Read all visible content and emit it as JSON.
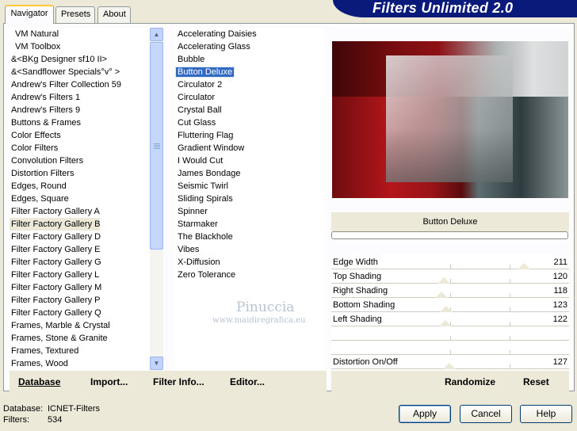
{
  "banner": {
    "title": "Filters Unlimited 2.0"
  },
  "tabs": [
    "Navigator",
    "Presets",
    "About"
  ],
  "categories": [
    "VM Natural",
    "VM Toolbox",
    "&<BKg Designer sf10 II>",
    "&<Sandflower Specials°v° >",
    "Andrew's Filter Collection 59",
    "Andrew's Filters 1",
    "Andrew's Filters 9",
    "Buttons & Frames",
    "Color Effects",
    "Color Filters",
    "Convolution Filters",
    "Distortion Filters",
    "Edges, Round",
    "Edges, Square",
    "Filter Factory Gallery A",
    "Filter Factory Gallery B",
    "Filter Factory Gallery D",
    "Filter Factory Gallery E",
    "Filter Factory Gallery G",
    "Filter Factory Gallery L",
    "Filter Factory Gallery M",
    "Filter Factory Gallery P",
    "Filter Factory Gallery Q",
    "Frames, Marble & Crystal",
    "Frames, Stone & Granite",
    "Frames, Textured",
    "Frames, Wood"
  ],
  "selected_category": "Filter Factory Gallery B",
  "filters": [
    "Accelerating Daisies",
    "Accelerating Glass",
    "Bubble",
    "Button Deluxe",
    "Circulator 2",
    "Circulator",
    "Crystal Ball",
    "Cut Glass",
    "Fluttering Flag",
    "Gradient Window",
    "I Would Cut",
    "James Bondage",
    "Seismic Twirl",
    "Sliding Spirals",
    "Spinner",
    "Starmaker",
    "The Blackhole",
    "Vibes",
    "X-Diffusion",
    "Zero Tolerance"
  ],
  "selected_filter": "Button Deluxe",
  "watermark": {
    "line1": "Pinuccia",
    "line2": "www.maidiregrafica.eu"
  },
  "left_buttons": {
    "database": "Database",
    "import": "Import...",
    "filter_info": "Filter Info...",
    "editor": "Editor..."
  },
  "filter_name": "Button Deluxe",
  "sliders": [
    {
      "label": "Edge Width",
      "value": "211",
      "level": 0.827
    },
    {
      "label": "Top Shading",
      "value": "120",
      "level": 0.471
    },
    {
      "label": "Right Shading",
      "value": "118",
      "level": 0.463
    },
    {
      "label": "Bottom Shading",
      "value": "123",
      "level": 0.482
    },
    {
      "label": "Left Shading",
      "value": "122",
      "level": 0.478
    },
    {
      "label": "",
      "value": "",
      "level": null
    },
    {
      "label": "",
      "value": "",
      "level": null
    },
    {
      "label": "Distortion On/Off",
      "value": "127",
      "level": 0.498
    }
  ],
  "right_buttons": {
    "randomize": "Randomize",
    "reset": "Reset"
  },
  "status": {
    "database_label": "Database:",
    "database_value": "ICNET-Filters",
    "filters_label": "Filters:",
    "filters_value": "534"
  },
  "dialog_buttons": {
    "apply": "Apply",
    "cancel": "Cancel",
    "help": "Help"
  },
  "colors": {
    "banner": "#0a1a7a",
    "selection": "#316ac5",
    "face": "#ece9d8"
  }
}
